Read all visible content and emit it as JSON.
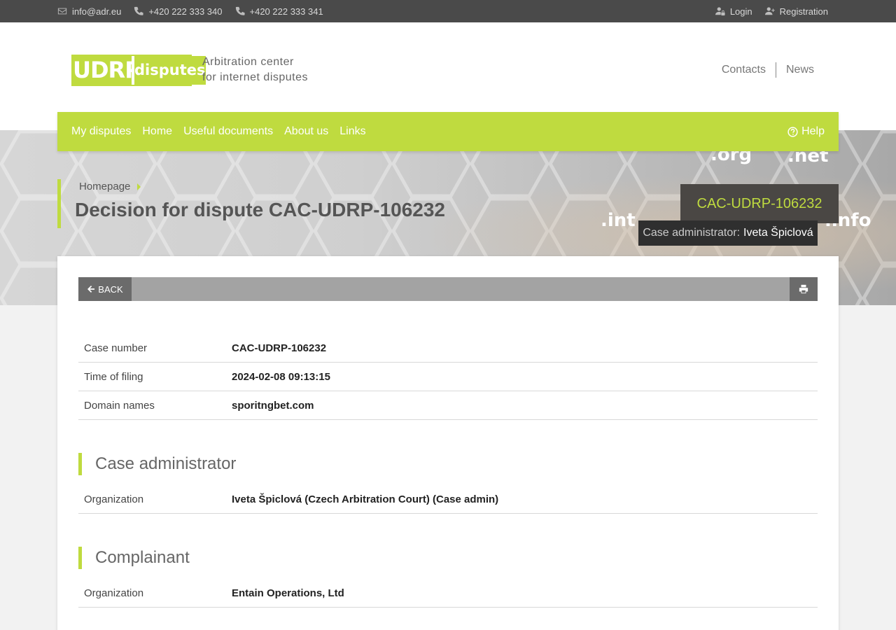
{
  "topbar": {
    "email": "info@adr.eu",
    "phone1": "+420 222 333 340",
    "phone2": "+420 222 333 341",
    "login": "Login",
    "registration": "Registration"
  },
  "header": {
    "logo_part1": "UDRP",
    "logo_part2": "disputes",
    "tagline_line1": "Arbitration center",
    "tagline_line2": "for internet disputes",
    "links": [
      "Contacts",
      "News"
    ]
  },
  "nav": {
    "items": [
      "My disputes",
      "Home",
      "Useful documents",
      "About us",
      "Links"
    ],
    "help": "Help"
  },
  "banner": {
    "domains": [
      ".org",
      ".net",
      ".int",
      ".info"
    ]
  },
  "breadcrumb": {
    "home": "Homepage"
  },
  "page": {
    "title": "Decision for dispute CAC-UDRP-106232",
    "case_tag": "CAC-UDRP-106232",
    "admin_label": "Case administrator:",
    "admin_name": "Iveta Špiclová"
  },
  "toolbar": {
    "back": "BACK"
  },
  "details": {
    "rows": [
      {
        "label": "Case number",
        "value": "CAC-UDRP-106232"
      },
      {
        "label": "Time of filing",
        "value": "2024-02-08 09:13:15"
      },
      {
        "label": "Domain names",
        "value": "sporitngbet.com"
      }
    ]
  },
  "case_admin": {
    "heading": "Case administrator",
    "org_label": "Organization",
    "org_value": "Iveta Špiclová (Czech Arbitration Court) (Case admin)"
  },
  "complainant": {
    "heading": "Complainant",
    "org_label": "Organization",
    "org_value": "Entain Operations, Ltd"
  },
  "colors": {
    "accent": "#bfdb3f",
    "topbar": "#4a4a4a",
    "dark_tag": "#4a4744"
  }
}
